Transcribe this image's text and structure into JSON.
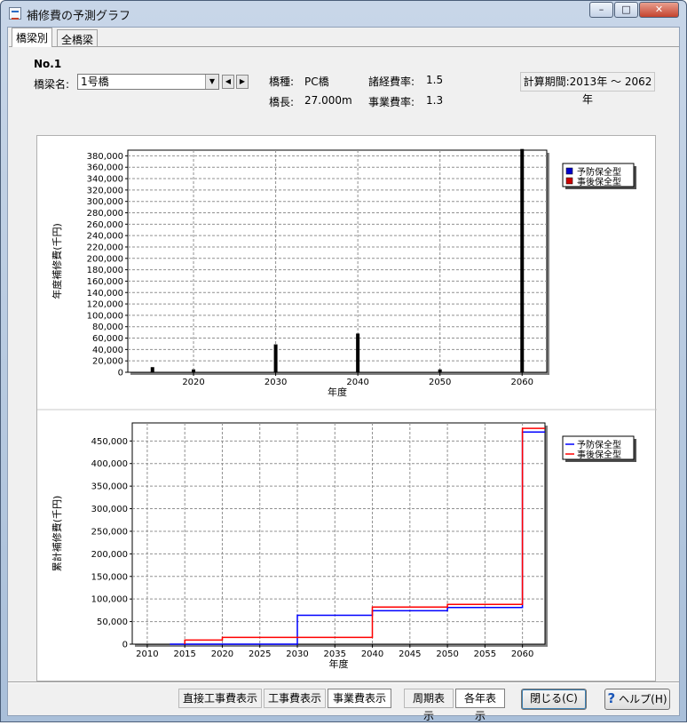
{
  "window": {
    "title": "補修費の予測グラフ",
    "minimize_glyph": "–",
    "maximize_glyph": "□",
    "close_glyph": "✕"
  },
  "tabs": [
    {
      "label": "橋梁別",
      "active": true
    },
    {
      "label": "全橋梁",
      "active": false
    }
  ],
  "bridge": {
    "number": "No.1",
    "name_label": "橋梁名:",
    "name_value": "1号橋",
    "type_label": "橋種:",
    "type_value": "PC橋",
    "length_label": "橋長:",
    "length_value": "27.000m",
    "overhead_rate_label": "諸経費率:",
    "overhead_rate_value": "1.5",
    "business_rate_label": "事業費率:",
    "business_rate_value": "1.3"
  },
  "period_button": "計算期間:2013年 〜 2062年",
  "nav": {
    "prev_glyph": "◀",
    "next_glyph": "▶",
    "dropdown_glyph": "▼"
  },
  "toolbar": {
    "direct_cost": "直接工事費表示",
    "construction_cost": "工事費表示",
    "business_cost": "事業費表示",
    "cycle_display": "周期表示",
    "annual_display": "各年表示",
    "close": "閉じる(C)",
    "help": "ヘルプ(H)",
    "help_glyph": "?"
  },
  "chart_data": [
    {
      "type": "bar",
      "ylabel": "年度補修費(千円)",
      "xlabel": "年度",
      "ylim": [
        0,
        390000
      ],
      "xlim": [
        2012,
        2063
      ],
      "xticks": [
        2020,
        2030,
        2040,
        2050,
        2060
      ],
      "yticks": [
        0,
        20000,
        40000,
        60000,
        80000,
        100000,
        120000,
        140000,
        160000,
        180000,
        200000,
        220000,
        240000,
        260000,
        280000,
        300000,
        320000,
        340000,
        360000,
        380000
      ],
      "ytick_labels": [
        "0",
        "20,000",
        "40,000",
        "60,000",
        "80,000",
        "100,000",
        "120,000",
        "140,000",
        "160,000",
        "180,000",
        "200,000",
        "220,000",
        "240,000",
        "260,000",
        "280,000",
        "300,000",
        "320,000",
        "340,000",
        "360,000",
        "380,000"
      ],
      "grid": true,
      "legend_position": "right",
      "series": [
        {
          "name": "予防保全型",
          "color": "#0000cc",
          "points": [
            [
              2015,
              9000
            ],
            [
              2020,
              5000
            ],
            [
              2030,
              49000
            ],
            [
              2040,
              68000
            ],
            [
              2050,
              5000
            ],
            [
              2060,
              392000
            ]
          ]
        },
        {
          "name": "事後保全型",
          "color": "#cc0000",
          "points": [
            [
              2015,
              9000
            ],
            [
              2020,
              5000
            ],
            [
              2040,
              5000
            ],
            [
              2050,
              5000
            ],
            [
              2060,
              392000
            ]
          ]
        }
      ]
    },
    {
      "type": "line",
      "ylabel": "累計補修費(千円)",
      "xlabel": "年度",
      "ylim": [
        0,
        490000
      ],
      "xlim": [
        2008,
        2063
      ],
      "xticks": [
        2010,
        2015,
        2020,
        2025,
        2030,
        2035,
        2040,
        2045,
        2050,
        2055,
        2060
      ],
      "yticks": [
        0,
        50000,
        100000,
        150000,
        200000,
        250000,
        300000,
        350000,
        400000,
        450000
      ],
      "ytick_labels": [
        "0",
        "50,000",
        "100,000",
        "150,000",
        "200,000",
        "250,000",
        "300,000",
        "350,000",
        "400,000",
        "450,000"
      ],
      "grid": true,
      "legend_position": "right",
      "series": [
        {
          "name": "予防保全型",
          "color": "#0000ff",
          "step": [
            [
              2013,
              0
            ],
            [
              2030,
              0
            ],
            [
              2030,
              64000
            ],
            [
              2040,
              64000
            ],
            [
              2040,
              74000
            ],
            [
              2050,
              74000
            ],
            [
              2050,
              81000
            ],
            [
              2060,
              81000
            ],
            [
              2060,
              470000
            ],
            [
              2063,
              470000
            ]
          ]
        },
        {
          "name": "事後保全型",
          "color": "#ff0000",
          "step": [
            [
              2015,
              0
            ],
            [
              2015,
              9000
            ],
            [
              2020,
              9000
            ],
            [
              2020,
              15000
            ],
            [
              2040,
              15000
            ],
            [
              2040,
              82000
            ],
            [
              2050,
              82000
            ],
            [
              2050,
              88000
            ],
            [
              2060,
              88000
            ],
            [
              2060,
              478000
            ],
            [
              2063,
              478000
            ]
          ]
        }
      ]
    }
  ]
}
